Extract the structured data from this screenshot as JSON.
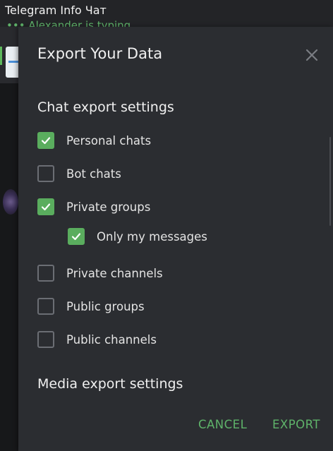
{
  "background": {
    "chat_title": "Telegram Info Чат",
    "typing_status": "••• Alexander is typing"
  },
  "dialog": {
    "title": "Export Your Data",
    "close_icon": "close-icon",
    "chat_section": {
      "title": "Chat export settings",
      "options": [
        {
          "label": "Personal chats",
          "checked": true
        },
        {
          "label": "Bot chats",
          "checked": false
        },
        {
          "label": "Private groups",
          "checked": true
        },
        {
          "label": "Only my messages",
          "checked": true
        },
        {
          "label": "Private channels",
          "checked": false
        },
        {
          "label": "Public groups",
          "checked": false
        },
        {
          "label": "Public channels",
          "checked": false
        }
      ]
    },
    "media_section": {
      "title": "Media export settings"
    },
    "buttons": {
      "cancel": "CANCEL",
      "export": "EXPORT"
    }
  },
  "colors": {
    "accent": "#5aad5e",
    "dialog_bg": "#2b2d31",
    "text": "#e4e4e4"
  }
}
